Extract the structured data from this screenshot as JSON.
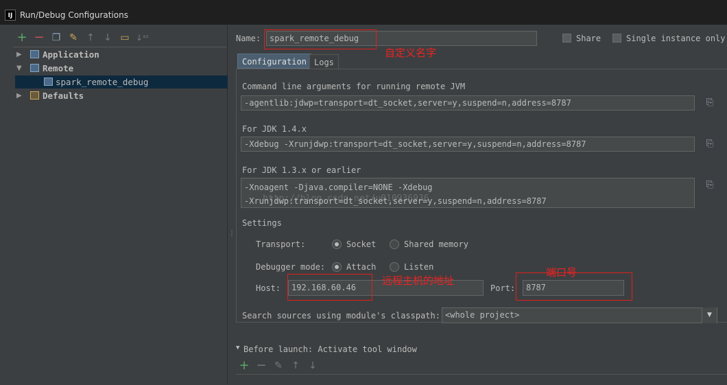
{
  "window": {
    "title": "Run/Debug Configurations",
    "logo": "IJ"
  },
  "toolbar": {
    "icons": [
      {
        "name": "add-icon",
        "glyph": "+"
      },
      {
        "name": "remove-icon",
        "glyph": "−"
      },
      {
        "name": "copy-icon",
        "glyph": "❐"
      },
      {
        "name": "wrench-icon",
        "glyph": "🔧"
      },
      {
        "name": "move-up-icon",
        "glyph": "↑"
      },
      {
        "name": "move-down-icon",
        "glyph": "↓"
      },
      {
        "name": "folder-icon",
        "glyph": "▭"
      },
      {
        "name": "sort-icon",
        "glyph": "↓ᵃᶻ"
      }
    ]
  },
  "tree": {
    "items": [
      {
        "label": "Application",
        "arrow": "▶",
        "level": 0
      },
      {
        "label": "Remote",
        "arrow": "▼",
        "level": 0
      },
      {
        "label": "spark_remote_debug",
        "arrow": "",
        "level": 1,
        "selected": true
      },
      {
        "label": "Defaults",
        "arrow": "▶",
        "level": 0
      }
    ]
  },
  "form": {
    "name_label": "Name:",
    "name_value": "spark_remote_debug",
    "share_label": "Share",
    "single_instance_label": "Single instance only"
  },
  "tabs": [
    {
      "label": "Configuration",
      "active": true
    },
    {
      "label": "Logs",
      "active": false
    }
  ],
  "config": {
    "cmd_label": "Command line arguments for running remote JVM",
    "cmd_value": "-agentlib:jdwp=transport=dt_socket,server=y,suspend=n,address=8787",
    "jdk14_label": "For JDK 1.4.x",
    "jdk14_value": "-Xdebug -Xrunjdwp:transport=dt_socket,server=y,suspend=n,address=8787",
    "jdk13_label": "For JDK 1.3.x or earlier",
    "jdk13_line1": "-Xnoagent -Djava.compiler=NONE -Xdebug",
    "jdk13_line2": "-Xrunjdwp:transport=dt_socket,server=y,suspend=n,address=8787",
    "watermark": "http://blog.csdn.net/u010936936",
    "settings_label": "Settings",
    "transport_label": "Transport:",
    "transport_options": [
      {
        "label": "Socket",
        "selected": true
      },
      {
        "label": "Shared memory",
        "selected": false
      }
    ],
    "debugger_mode_label": "Debugger mode:",
    "debugger_mode_options": [
      {
        "label": "Attach",
        "selected": true
      },
      {
        "label": "Listen",
        "selected": false
      }
    ],
    "host_label": "Host:",
    "host_value": "192.168.60.46",
    "port_label": "Port:",
    "port_value": "8787",
    "classpath_label": "Search sources using module's classpath:",
    "classpath_value": "<whole project>"
  },
  "before_launch": {
    "label": "Before launch: Activate tool window",
    "toolbar": [
      "add-icon",
      "remove-icon",
      "edit-icon",
      "move-up-icon",
      "move-down-icon"
    ]
  },
  "annotations": {
    "name_note": "自定义名字",
    "host_note": "远程主机的地址",
    "port_note": "端口号"
  },
  "colors": {
    "background": "#3c3f41",
    "selection": "#0d293e",
    "annotation_red": "#ee2222",
    "active_tab": "#4b5f71"
  }
}
